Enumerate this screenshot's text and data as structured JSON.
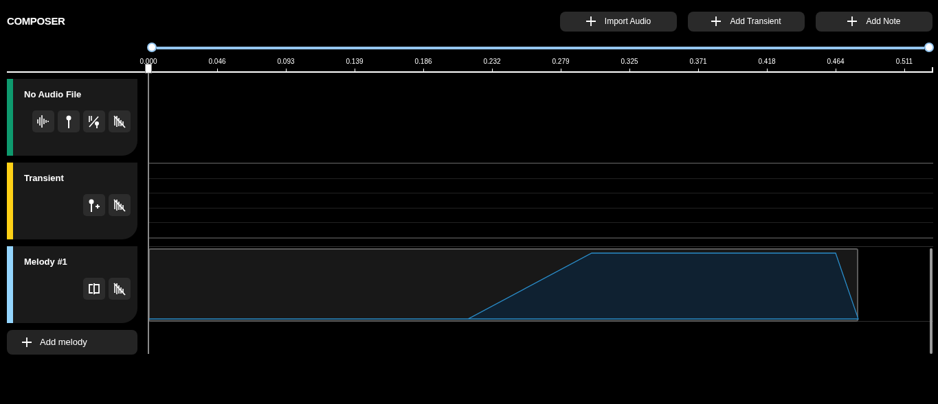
{
  "title": "COMPOSER",
  "buttons": [
    {
      "label": "Import Audio"
    },
    {
      "label": "Add Transient"
    },
    {
      "label": "Add Note"
    }
  ],
  "range_slider": {
    "level": 1
  },
  "ruler_ticks": [
    "0.000",
    "0.046",
    "0.093",
    "0.139",
    "0.186",
    "0.232",
    "0.279",
    "0.325",
    "0.371",
    "0.418",
    "0.464",
    "0.511"
  ],
  "tracks": [
    {
      "kind": "audio",
      "name": "No Audio File",
      "color": "#0e9a6e",
      "tools": [
        {
          "kind": "waveform"
        },
        {
          "kind": "marker"
        },
        {
          "kind": "slice"
        },
        {
          "kind": "mute"
        }
      ]
    },
    {
      "kind": "transient",
      "name": "Transient",
      "color": "#fdd016",
      "tools": [
        {
          "kind": "add-marker"
        },
        {
          "kind": "mute"
        }
      ]
    },
    {
      "kind": "melody",
      "name": "Melody #1",
      "color": "#94d5fd",
      "tools": [
        {
          "kind": "split"
        },
        {
          "kind": "mute"
        }
      ]
    }
  ],
  "add_melody": {
    "label": "Add melody"
  }
}
